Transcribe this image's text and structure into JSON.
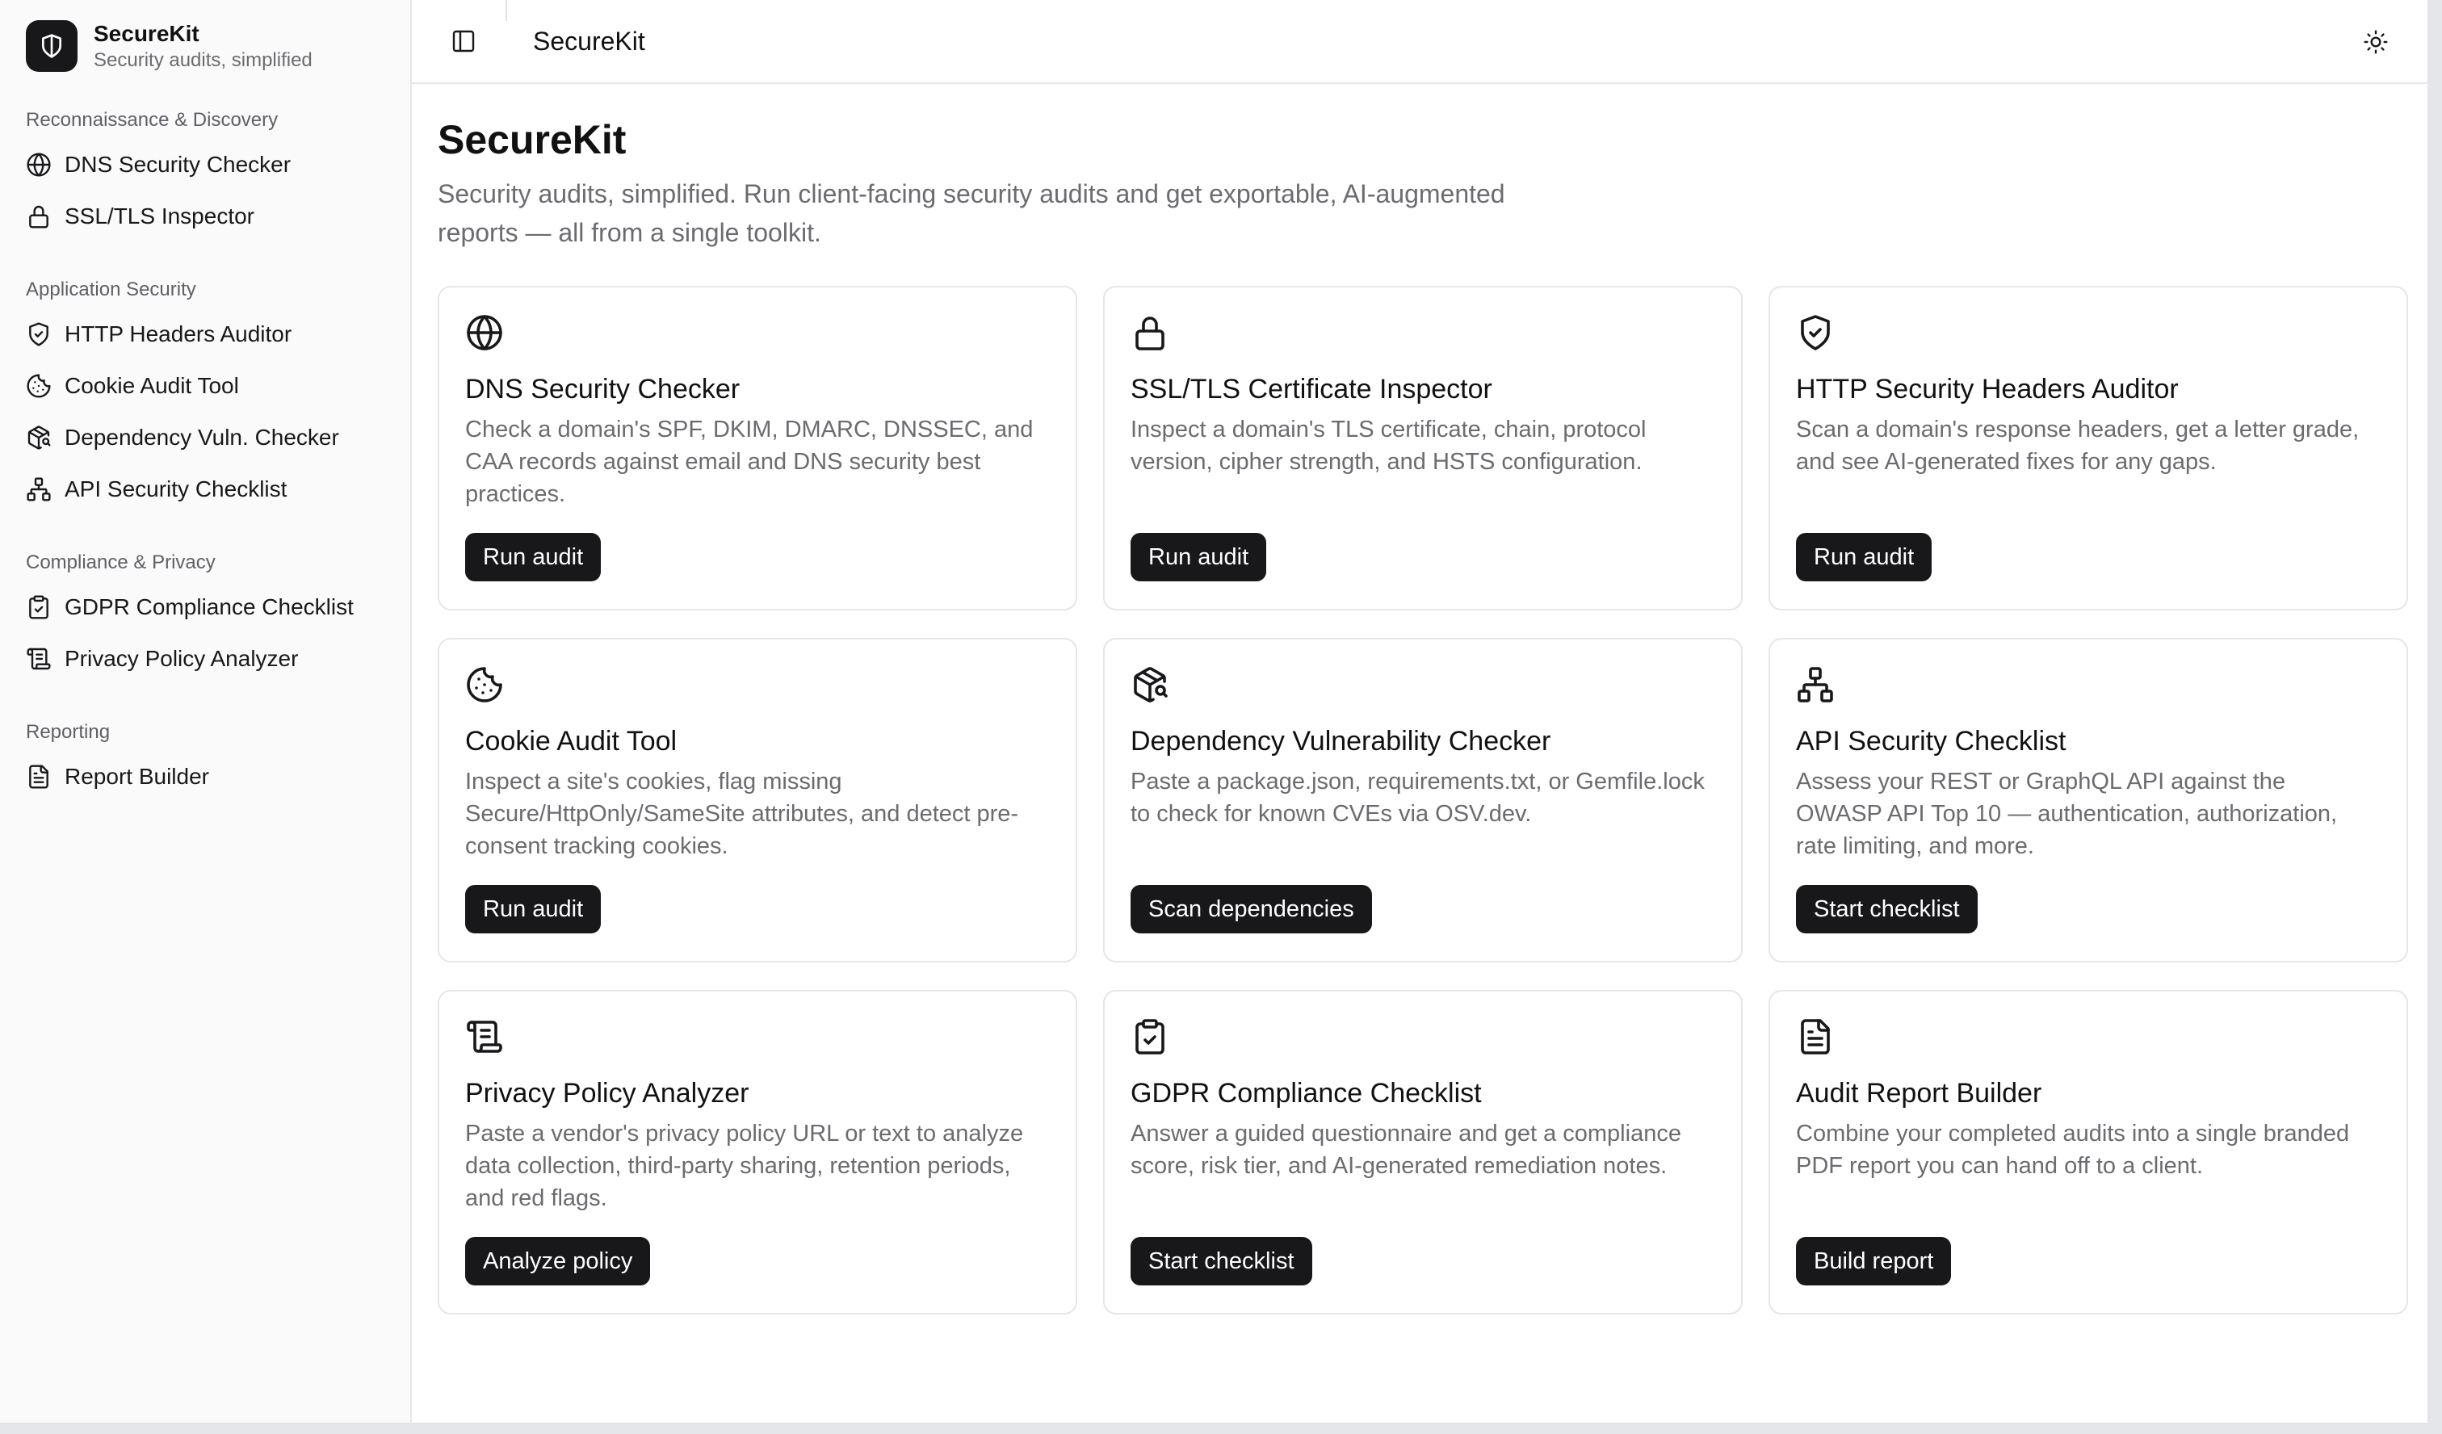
{
  "brand": {
    "name": "SecureKit",
    "tagline": "Security audits, simplified"
  },
  "sidebar": {
    "groups": [
      {
        "title": "Reconnaissance & Discovery",
        "items": [
          {
            "label": "DNS Security Checker",
            "icon": "globe-icon"
          },
          {
            "label": "SSL/TLS Inspector",
            "icon": "lock-icon"
          }
        ]
      },
      {
        "title": "Application Security",
        "items": [
          {
            "label": "HTTP Headers Auditor",
            "icon": "shield-check-icon"
          },
          {
            "label": "Cookie Audit Tool",
            "icon": "cookie-icon"
          },
          {
            "label": "Dependency Vuln. Checker",
            "icon": "package-search-icon"
          },
          {
            "label": "API Security Checklist",
            "icon": "network-icon"
          }
        ]
      },
      {
        "title": "Compliance & Privacy",
        "items": [
          {
            "label": "GDPR Compliance Checklist",
            "icon": "clipboard-check-icon"
          },
          {
            "label": "Privacy Policy Analyzer",
            "icon": "scroll-text-icon"
          }
        ]
      },
      {
        "title": "Reporting",
        "items": [
          {
            "label": "Report Builder",
            "icon": "file-text-icon"
          }
        ]
      }
    ]
  },
  "topbar": {
    "title": "SecureKit"
  },
  "page": {
    "title": "SecureKit",
    "description": "Security audits, simplified. Run client-facing security audits and get exportable, AI-augmented reports — all from a single toolkit."
  },
  "cards": [
    {
      "title": "DNS Security Checker",
      "description": "Check a domain's SPF, DKIM, DMARC, DNSSEC, and CAA records against email and DNS security best practices.",
      "button": "Run audit",
      "icon": "globe-icon"
    },
    {
      "title": "SSL/TLS Certificate Inspector",
      "description": "Inspect a domain's TLS certificate, chain, protocol version, cipher strength, and HSTS configuration.",
      "button": "Run audit",
      "icon": "lock-icon"
    },
    {
      "title": "HTTP Security Headers Auditor",
      "description": "Scan a domain's response headers, get a letter grade, and see AI-generated fixes for any gaps.",
      "button": "Run audit",
      "icon": "shield-check-icon"
    },
    {
      "title": "Cookie Audit Tool",
      "description": "Inspect a site's cookies, flag missing Secure/HttpOnly/SameSite attributes, and detect pre-consent tracking cookies.",
      "button": "Run audit",
      "icon": "cookie-icon"
    },
    {
      "title": "Dependency Vulnerability Checker",
      "description": "Paste a package.json, requirements.txt, or Gemfile.lock to check for known CVEs via OSV.dev.",
      "button": "Scan dependencies",
      "icon": "package-search-icon"
    },
    {
      "title": "API Security Checklist",
      "description": "Assess your REST or GraphQL API against the OWASP API Top 10 — authentication, authorization, rate limiting, and more.",
      "button": "Start checklist",
      "icon": "network-icon"
    },
    {
      "title": "Privacy Policy Analyzer",
      "description": "Paste a vendor's privacy policy URL or text to analyze data collection, third-party sharing, retention periods, and red flags.",
      "button": "Analyze policy",
      "icon": "scroll-text-icon"
    },
    {
      "title": "GDPR Compliance Checklist",
      "description": "Answer a guided questionnaire and get a compliance score, risk tier, and AI-generated remediation notes.",
      "button": "Start checklist",
      "icon": "clipboard-check-icon"
    },
    {
      "title": "Audit Report Builder",
      "description": "Combine your completed audits into a single branded PDF report you can hand off to a client.",
      "button": "Build report",
      "icon": "file-text-icon"
    }
  ]
}
